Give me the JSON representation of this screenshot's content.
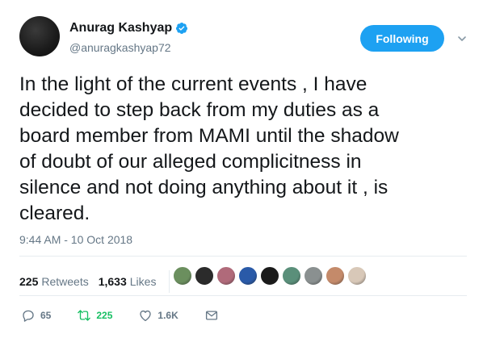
{
  "user": {
    "display_name": "Anurag Kashyap",
    "handle": "@anuragkashyap72",
    "verified": true
  },
  "follow_button": {
    "label": "Following"
  },
  "tweet": {
    "text": "In the light of the current events , I have\ndecided to step back from my duties as a\nboard member from MAMI until the shadow\nof doubt of our alleged complicitness in\nsilence and not doing anything about it , is\ncleared.",
    "timestamp": "9:44 AM - 10 Oct 2018"
  },
  "stats": {
    "retweets_count": "225",
    "retweets_label": "Retweets",
    "likes_count": "1,633",
    "likes_label": "Likes"
  },
  "liker_avatars": [
    {
      "color": "#6b8f5e"
    },
    {
      "color": "#2b2b2b"
    },
    {
      "color": "#b06a7a"
    },
    {
      "color": "#2a5aa8"
    },
    {
      "color": "#1a1a1a"
    },
    {
      "color": "#5a8f7a"
    },
    {
      "color": "#8a9090"
    },
    {
      "color": "#c48a6a"
    },
    {
      "color": "#d8c8b8"
    }
  ],
  "actions": {
    "reply_count": "65",
    "retweet_count": "225",
    "like_count": "1.6K"
  },
  "colors": {
    "accent": "#1da1f2",
    "retweet_green": "#17bf63",
    "muted": "#657786"
  }
}
